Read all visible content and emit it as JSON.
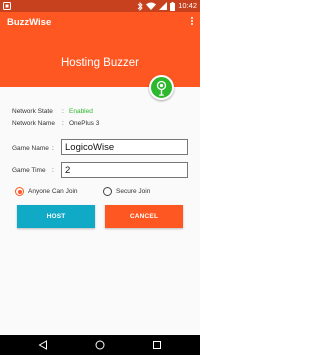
{
  "status_bar": {
    "time": "10:42",
    "icons": [
      "notification-icon",
      "bluetooth-icon",
      "wifi-icon",
      "signal-icon",
      "battery-icon"
    ]
  },
  "app_bar": {
    "title": "BuzzWise",
    "overflow_icon": "more-vert-icon"
  },
  "banner": {
    "title": "Hosting Buzzer",
    "fab_icon": "buzzer-icon"
  },
  "network": {
    "state_label": "Network State",
    "state_colon": ":",
    "state_value": "Enabled",
    "name_label": "Network Name",
    "name_colon": ":",
    "name_value": "OnePlus 3"
  },
  "form": {
    "game_name_label": "Game Name",
    "game_name_colon": ":",
    "game_name_value": "LogicoWise",
    "game_time_label": "Game Time",
    "game_time_colon": ":",
    "game_time_value": "2"
  },
  "join_options": {
    "anyone": "Anyone Can Join",
    "secure": "Secure Join",
    "selected": "anyone"
  },
  "buttons": {
    "host": "HOST",
    "cancel": "CANCEL"
  },
  "nav_bar": {
    "icons": [
      "back-icon",
      "home-icon",
      "recents-icon"
    ]
  },
  "colors": {
    "primary": "#ff5722",
    "status_bar": "#c8411e",
    "accent_green": "#2eb82e",
    "host_button": "#10aac6"
  }
}
